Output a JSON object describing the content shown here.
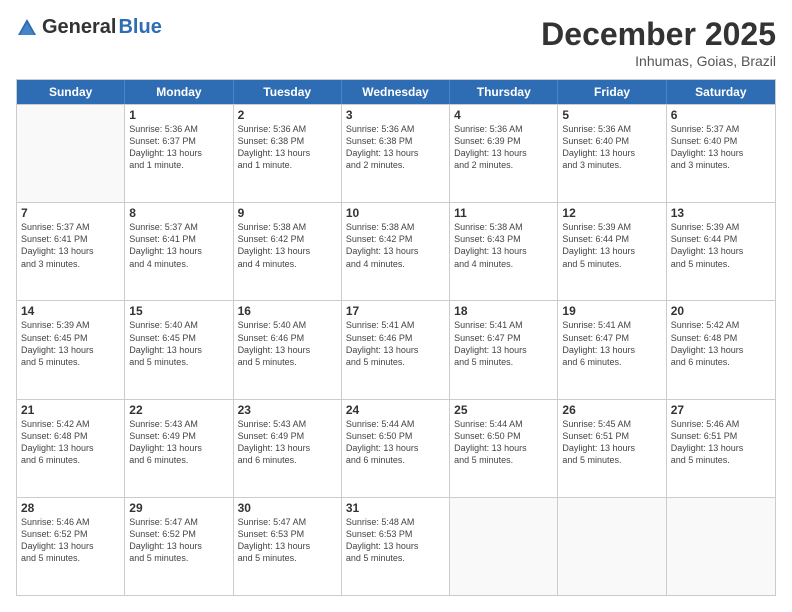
{
  "logo": {
    "general": "General",
    "blue": "Blue"
  },
  "title": "December 2025",
  "location": "Inhumas, Goias, Brazil",
  "weekdays": [
    "Sunday",
    "Monday",
    "Tuesday",
    "Wednesday",
    "Thursday",
    "Friday",
    "Saturday"
  ],
  "weeks": [
    [
      {
        "day": null,
        "info": null
      },
      {
        "day": "1",
        "info": "Sunrise: 5:36 AM\nSunset: 6:37 PM\nDaylight: 13 hours\nand 1 minute."
      },
      {
        "day": "2",
        "info": "Sunrise: 5:36 AM\nSunset: 6:38 PM\nDaylight: 13 hours\nand 1 minute."
      },
      {
        "day": "3",
        "info": "Sunrise: 5:36 AM\nSunset: 6:38 PM\nDaylight: 13 hours\nand 2 minutes."
      },
      {
        "day": "4",
        "info": "Sunrise: 5:36 AM\nSunset: 6:39 PM\nDaylight: 13 hours\nand 2 minutes."
      },
      {
        "day": "5",
        "info": "Sunrise: 5:36 AM\nSunset: 6:40 PM\nDaylight: 13 hours\nand 3 minutes."
      },
      {
        "day": "6",
        "info": "Sunrise: 5:37 AM\nSunset: 6:40 PM\nDaylight: 13 hours\nand 3 minutes."
      }
    ],
    [
      {
        "day": "7",
        "info": "Sunrise: 5:37 AM\nSunset: 6:41 PM\nDaylight: 13 hours\nand 3 minutes."
      },
      {
        "day": "8",
        "info": "Sunrise: 5:37 AM\nSunset: 6:41 PM\nDaylight: 13 hours\nand 4 minutes."
      },
      {
        "day": "9",
        "info": "Sunrise: 5:38 AM\nSunset: 6:42 PM\nDaylight: 13 hours\nand 4 minutes."
      },
      {
        "day": "10",
        "info": "Sunrise: 5:38 AM\nSunset: 6:42 PM\nDaylight: 13 hours\nand 4 minutes."
      },
      {
        "day": "11",
        "info": "Sunrise: 5:38 AM\nSunset: 6:43 PM\nDaylight: 13 hours\nand 4 minutes."
      },
      {
        "day": "12",
        "info": "Sunrise: 5:39 AM\nSunset: 6:44 PM\nDaylight: 13 hours\nand 5 minutes."
      },
      {
        "day": "13",
        "info": "Sunrise: 5:39 AM\nSunset: 6:44 PM\nDaylight: 13 hours\nand 5 minutes."
      }
    ],
    [
      {
        "day": "14",
        "info": "Sunrise: 5:39 AM\nSunset: 6:45 PM\nDaylight: 13 hours\nand 5 minutes."
      },
      {
        "day": "15",
        "info": "Sunrise: 5:40 AM\nSunset: 6:45 PM\nDaylight: 13 hours\nand 5 minutes."
      },
      {
        "day": "16",
        "info": "Sunrise: 5:40 AM\nSunset: 6:46 PM\nDaylight: 13 hours\nand 5 minutes."
      },
      {
        "day": "17",
        "info": "Sunrise: 5:41 AM\nSunset: 6:46 PM\nDaylight: 13 hours\nand 5 minutes."
      },
      {
        "day": "18",
        "info": "Sunrise: 5:41 AM\nSunset: 6:47 PM\nDaylight: 13 hours\nand 5 minutes."
      },
      {
        "day": "19",
        "info": "Sunrise: 5:41 AM\nSunset: 6:47 PM\nDaylight: 13 hours\nand 6 minutes."
      },
      {
        "day": "20",
        "info": "Sunrise: 5:42 AM\nSunset: 6:48 PM\nDaylight: 13 hours\nand 6 minutes."
      }
    ],
    [
      {
        "day": "21",
        "info": "Sunrise: 5:42 AM\nSunset: 6:48 PM\nDaylight: 13 hours\nand 6 minutes."
      },
      {
        "day": "22",
        "info": "Sunrise: 5:43 AM\nSunset: 6:49 PM\nDaylight: 13 hours\nand 6 minutes."
      },
      {
        "day": "23",
        "info": "Sunrise: 5:43 AM\nSunset: 6:49 PM\nDaylight: 13 hours\nand 6 minutes."
      },
      {
        "day": "24",
        "info": "Sunrise: 5:44 AM\nSunset: 6:50 PM\nDaylight: 13 hours\nand 6 minutes."
      },
      {
        "day": "25",
        "info": "Sunrise: 5:44 AM\nSunset: 6:50 PM\nDaylight: 13 hours\nand 5 minutes."
      },
      {
        "day": "26",
        "info": "Sunrise: 5:45 AM\nSunset: 6:51 PM\nDaylight: 13 hours\nand 5 minutes."
      },
      {
        "day": "27",
        "info": "Sunrise: 5:46 AM\nSunset: 6:51 PM\nDaylight: 13 hours\nand 5 minutes."
      }
    ],
    [
      {
        "day": "28",
        "info": "Sunrise: 5:46 AM\nSunset: 6:52 PM\nDaylight: 13 hours\nand 5 minutes."
      },
      {
        "day": "29",
        "info": "Sunrise: 5:47 AM\nSunset: 6:52 PM\nDaylight: 13 hours\nand 5 minutes."
      },
      {
        "day": "30",
        "info": "Sunrise: 5:47 AM\nSunset: 6:53 PM\nDaylight: 13 hours\nand 5 minutes."
      },
      {
        "day": "31",
        "info": "Sunrise: 5:48 AM\nSunset: 6:53 PM\nDaylight: 13 hours\nand 5 minutes."
      },
      {
        "day": null,
        "info": null
      },
      {
        "day": null,
        "info": null
      },
      {
        "day": null,
        "info": null
      }
    ]
  ]
}
